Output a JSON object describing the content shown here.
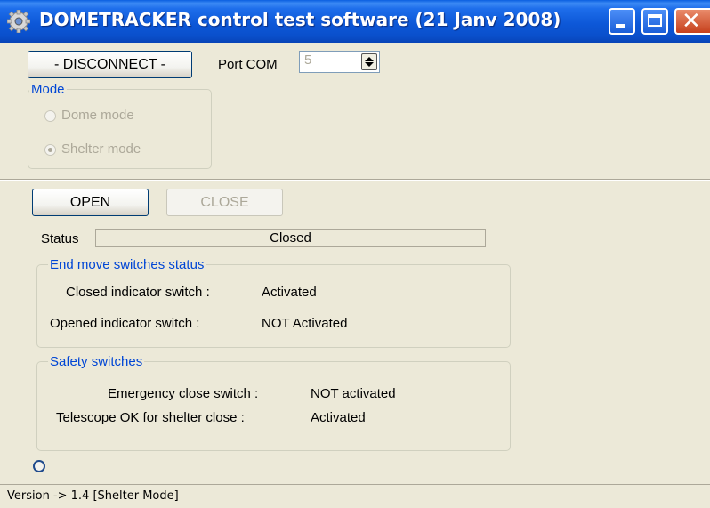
{
  "window": {
    "title": "DOMETRACKER control test software (21 Janv 2008)",
    "icon": "gear-icon",
    "controls": [
      "minimize-icon",
      "maximize-icon",
      "close-icon"
    ]
  },
  "connection": {
    "disconnect_label": "- DISCONNECT -",
    "port_label": "Port COM",
    "port_value": "5"
  },
  "mode": {
    "legend": "Mode",
    "options": [
      {
        "label": "Dome mode",
        "selected": false
      },
      {
        "label": "Shelter mode",
        "selected": true
      }
    ]
  },
  "actions": {
    "open_label": "OPEN",
    "close_label": "CLOSE"
  },
  "status": {
    "label": "Status",
    "value": "Closed"
  },
  "end_switches": {
    "legend": "End move switches status",
    "closed_label": "Closed indicator switch :",
    "closed_value": "Activated",
    "opened_label": "Opened  indicator switch :",
    "opened_value": "NOT Activated"
  },
  "safety": {
    "legend": "Safety switches",
    "emergency_label": "Emergency close switch :",
    "emergency_value": "NOT activated",
    "telescope_label": "Telescope OK for shelter close :",
    "telescope_value": "Activated"
  },
  "statusbar": {
    "text": "Version -> 1.4 [Shelter Mode]"
  },
  "colors": {
    "titlebar": "#0A4FCB",
    "window_bg": "#ECE9D8",
    "group_legend": "#0046D5",
    "disabled_text": "#ACA899"
  }
}
